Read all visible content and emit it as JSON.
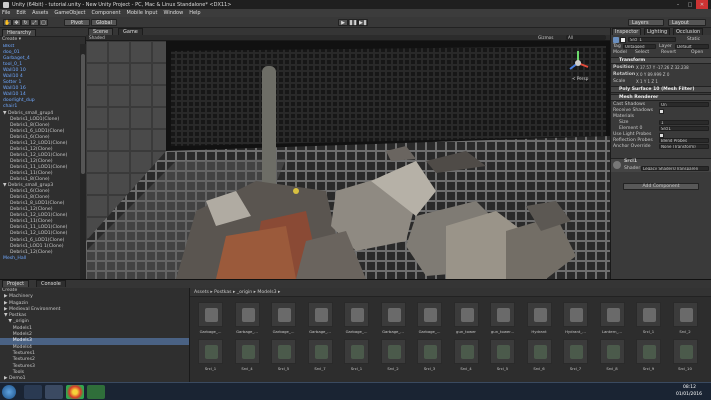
{
  "window": {
    "title": "Unity (64bit) - tutorial.unity - New Unity Project - PC, Mac & Linux Standalone* <DX11>"
  },
  "menu": [
    "File",
    "Edit",
    "Assets",
    "GameObject",
    "Component",
    "Mobile Input",
    "Window",
    "Help"
  ],
  "toolbar": {
    "pivot": "Pivot",
    "global": "Global",
    "layers": "Layers",
    "layout": "Layout"
  },
  "hierarchy": {
    "tab": "Hierarchy",
    "create": "Create",
    "rows": [
      {
        "text": "Blkst",
        "blue": true
      },
      {
        "text": "doo_01",
        "blue": true
      },
      {
        "text": "Garbaget_4",
        "blue": true
      },
      {
        "text": "tool_0_1",
        "blue": true
      },
      {
        "text": "Wall10 10",
        "blue": true
      },
      {
        "text": "Wall10 4",
        "blue": true
      },
      {
        "text": "Sotter 1",
        "blue": true
      },
      {
        "text": "Wall10 16",
        "blue": true
      },
      {
        "text": "Wall10 14",
        "blue": true
      },
      {
        "text": "doorlight_dup",
        "blue": true
      },
      {
        "text": "chair1",
        "blue": true
      },
      {
        "text": "▼ Debris_small_grup4",
        "blue": false
      },
      {
        "text": "Debris1_LOD1(Clone)"
      },
      {
        "text": "Debris1_8(Clone)"
      },
      {
        "text": "Debris1_6_LOD1(Clone)"
      },
      {
        "text": "Debris1_6(Clone)"
      },
      {
        "text": "Debris1_12_LOD1(Clone)"
      },
      {
        "text": "Debris1_12(Clone)"
      },
      {
        "text": "Debris1_12_LOD1(Clone)"
      },
      {
        "text": "Debris1_12(Clone)"
      },
      {
        "text": "Debris1_11_LOD1(Clone)"
      },
      {
        "text": "Debris1_11(Clone)"
      },
      {
        "text": "Debris1_8(Clone)"
      },
      {
        "text": "▼ Debris_small_grup3",
        "blue": false
      },
      {
        "text": "Debris1_6(Clone)"
      },
      {
        "text": "Debris1_8(Clone)"
      },
      {
        "text": "Debris1_8_LOD1(Clone)"
      },
      {
        "text": "Debris1_12(Clone)"
      },
      {
        "text": "Debris1_12_LOD1(Clone)"
      },
      {
        "text": "Debris1_11(Clone)"
      },
      {
        "text": "Debris1_11_LOD1(Clone)"
      },
      {
        "text": "Debris1_12_LOD1(Clone)"
      },
      {
        "text": "Debris1_6_LOD1(Clone)"
      },
      {
        "text": "Debris1_LOD1 1(Clone)"
      },
      {
        "text": "Debris1_12(Clone)"
      },
      {
        "text": "Mesh_Hall",
        "blue": true
      }
    ]
  },
  "scene": {
    "tab_scene": "Scene",
    "tab_game": "Game",
    "shaded": "Shaded",
    "gizmos": "Gizmos",
    "search": "All",
    "persp": "< Persp"
  },
  "inspector": {
    "tab_inspector": "Inspector",
    "tab_lighting": "Lighting",
    "tab_occlusion": "Occlusion",
    "object_name": "Srcl_1",
    "static": "Static",
    "tag_label": "Tag",
    "tag_value": "Untagged",
    "layer_label": "Layer",
    "layer_value": "Default",
    "model_label": "Model",
    "select": "Select",
    "revert": "Revert",
    "open": "Open",
    "transform": "Transform",
    "position_label": "Position",
    "position": "X 37.57  Y -17.26  Z 32.238",
    "rotation_label": "Rotation",
    "rotation": "X 0   Y 89.999  Z 0",
    "scale_label": "Scale",
    "scale": "X 1   Y 1   Z 1",
    "mesh_filter": "Poly Surface 10 (Mesh Filter)",
    "mesh_renderer": "Mesh Renderer",
    "cast_shadows_label": "Cast Shadows",
    "cast_shadows": "On",
    "receive_shadows": "Receive Shadows",
    "materials": "Materials",
    "size_label": "Size",
    "size": "1",
    "element_label": "Element 0",
    "element": "Srcl1",
    "use_light_probes": "Use Light Probes",
    "reflection_probes_label": "Reflection Probes",
    "reflection_probes": "Blend Probes",
    "anchor_label": "Anchor Override",
    "anchor": "None (Transform)",
    "material_name": "Srcl1",
    "shader_label": "Shader",
    "shader": "Legacy Shaders/Transparen",
    "add_component": "Add Component"
  },
  "project": {
    "tab_project": "Project",
    "tab_console": "Console",
    "create": "Create",
    "tree": [
      {
        "text": "▶ Machinery",
        "sel": false
      },
      {
        "text": "▶ Magazin",
        "sel": false
      },
      {
        "text": "▶ Medieval Environment",
        "sel": false
      },
      {
        "text": "▼ Postkas",
        "sel": false
      },
      {
        "text": "   ▼ _origin",
        "sel": false
      },
      {
        "text": "      Models1",
        "sel": false
      },
      {
        "text": "      Models2",
        "sel": false
      },
      {
        "text": "      Models3",
        "sel": true
      },
      {
        "text": "      Models4",
        "sel": false
      },
      {
        "text": "      Textures1",
        "sel": false
      },
      {
        "text": "      Textures2",
        "sel": false
      },
      {
        "text": "      Textures3",
        "sel": false
      },
      {
        "text": "      Tools",
        "sel": false
      },
      {
        "text": "▶ Demo1",
        "sel": false
      }
    ],
    "breadcrumb": "Assets ▸ Postkas ▸ _origin ▸ Models3 ▸",
    "row1": [
      "Garbage_...",
      "Garbage_...",
      "Garbage_...",
      "Garbage_...",
      "Garbage_...",
      "Garbage_...",
      "Garbage_...",
      "gun_tower",
      "gun_tower...",
      "Hydrant",
      "Hydrant_...",
      "Lantern_...",
      "Srcl_1",
      "Srcl_2"
    ],
    "row2": [
      "Srcl_1",
      "Srcl_4",
      "Srcl_5",
      "Srcl_7",
      "Srcl_1",
      "Srcl_2",
      "Srcl_3",
      "Srcl_4",
      "Srcl_5",
      "Srcl_6",
      "Srcl_7",
      "Srcl_8",
      "Srcl_9",
      "Srcl_10"
    ]
  },
  "taskbar": {
    "time": "08:12",
    "date": "01/01/2016"
  }
}
